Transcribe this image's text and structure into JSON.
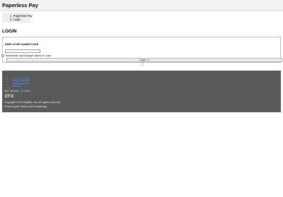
{
  "header": {
    "app_title": "Paperless Pay"
  },
  "breadcrumb": {
    "items": [
      {
        "label": "1. Paperless Pay"
      },
      {
        "label": "2. Login"
      }
    ]
  },
  "page": {
    "title": "LOGIN"
  },
  "login_form": {
    "employer_label": "EMPLOYER NAME/CODE",
    "employer_value": "",
    "remember_label": "Remember my Employer Name or Code",
    "remember_checked": false,
    "login_button_label": "Login >>",
    "loading_icon": "spinner-icon"
  },
  "footer": {
    "links": [
      {
        "label": "Privacy Notice"
      },
      {
        "label": "Terms of Use"
      },
      {
        "label": "Support"
      }
    ],
    "version": "Site Version : 17.6.5.1",
    "logo_text": "EFX",
    "copyright": "Copyright 2019 Equifax, Inc. All rights reserved.",
    "tagline": "Powering the World with Knowledge",
    "background_color": "#595959"
  }
}
